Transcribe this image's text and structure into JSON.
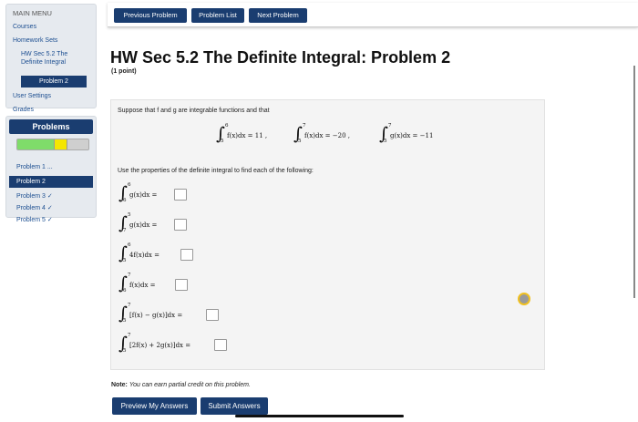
{
  "sidebar": {
    "menu_header": "MAIN MENU",
    "courses": "Courses",
    "homework_sets": "Homework Sets",
    "current_set_line1": "HW Sec 5.2 The",
    "current_set_line2": "Definite Integral",
    "current_problem": "Problem 2",
    "user_settings": "User Settings",
    "grades": "Grades"
  },
  "problems_panel": {
    "title": "Problems",
    "progress": [
      {
        "fraction": 0.52,
        "color": "#7fdc6a"
      },
      {
        "fraction": 0.18,
        "color": "#f5e600"
      },
      {
        "fraction": 0.3,
        "color": "#cfcfcf"
      }
    ],
    "items": [
      "Problem 1 ...",
      "Problem 2",
      "Problem 3 ✓",
      "Problem 4 ✓",
      "Problem 5 ✓"
    ]
  },
  "nav": {
    "previous": "Previous Problem",
    "list": "Problem List",
    "next": "Next Problem"
  },
  "header": {
    "title": "HW Sec 5.2 The Definite Integral: Problem 2",
    "points": "(1 point)"
  },
  "problem": {
    "intro": "Suppose that f and g are integrable functions and that",
    "given": [
      {
        "upper": "6",
        "lower": "5",
        "expr": "f(x)dx = 11 ,"
      },
      {
        "upper": "7",
        "lower": "5",
        "expr": "f(x)dx = −20 ,"
      },
      {
        "upper": "7",
        "lower": "5",
        "expr": "g(x)dx = −11"
      }
    ],
    "instruction": "Use the properties of the definite integral to find each of the following:",
    "questions": [
      {
        "upper": "6",
        "lower": "6",
        "expr": "g(x)dx ="
      },
      {
        "upper": "5",
        "lower": "7",
        "expr": "g(x)dx ="
      },
      {
        "upper": "6",
        "lower": "5",
        "expr": "4f(x)dx ="
      },
      {
        "upper": "7",
        "lower": "6",
        "expr": "f(x)dx ="
      },
      {
        "upper": "7",
        "lower": "5",
        "expr": "[f(x) − g(x)]dx ="
      },
      {
        "upper": "7",
        "lower": "5",
        "expr": "[2f(x) + 2g(x)]dx ="
      }
    ]
  },
  "note": {
    "label": "Note:",
    "text": "You can earn partial credit on this problem."
  },
  "actions": {
    "preview": "Preview My Answers",
    "submit": "Submit Answers"
  },
  "colors": {
    "primary": "#1a3d70",
    "link": "#1d4f91"
  }
}
